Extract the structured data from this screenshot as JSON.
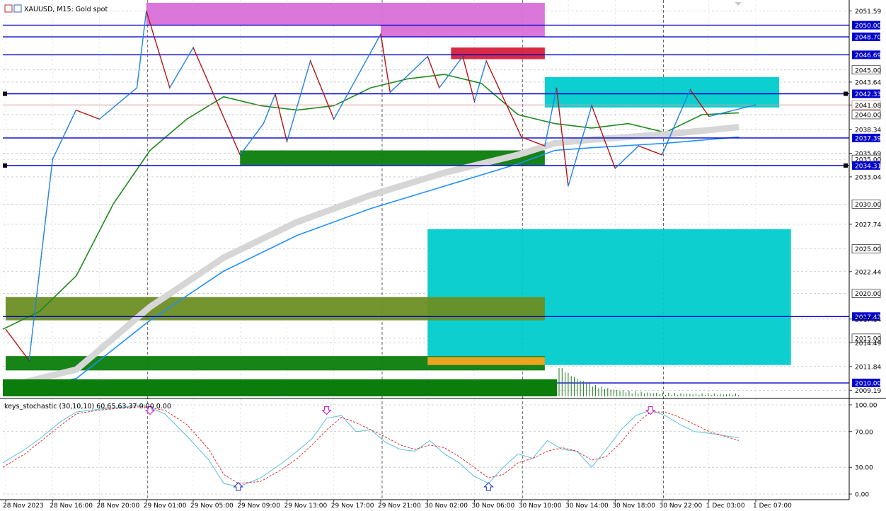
{
  "window": {
    "symbol": "XAUUSD",
    "timeframe": "M15",
    "description": "Gold spot",
    "title_text": "XAUUSD, M15:  Gold spot"
  },
  "colors": {
    "background": "#ffffff",
    "bull_candle": "#000000",
    "level_line": "#0000cc",
    "sma_green": "#1f8a1f",
    "sma_blue": "#1e90ff",
    "ribbon_gray": "#d6d6d6",
    "zone_magenta": "#d96fd9",
    "zone_red": "#d41f3b",
    "zone_cyan": "#00cccc",
    "zone_green": "#0a7d0a",
    "zone_olive": "#6b8e23",
    "zone_orange": "#f5a623",
    "zone_beige": "#fdebd3",
    "zone_lavender": "#e6e6f7",
    "stoch_main": "#5bc0de",
    "stoch_signal": "#e03030"
  },
  "chart_data": [
    {
      "type": "candlestick",
      "symbol": "XAUUSD",
      "timeframe": "M15",
      "title": "XAUUSD, M15:  Gold spot",
      "ylim": [
        2008.5,
        2052.5
      ],
      "grid": true,
      "y_ticks": [
        "2051.59",
        "2050.00",
        "2048.70",
        "2046.69",
        "2045.00",
        "2043.64",
        "2042.33",
        "2041.08",
        "2040.00",
        "2038.34",
        "2037.39",
        "2035.69",
        "2035.00",
        "2034.31",
        "2033.04",
        "2030.00",
        "2027.74",
        "2025.00",
        "2022.44",
        "2020.00",
        "2017.42",
        "2017.14",
        "2015.00",
        "2014.49",
        "2011.84",
        "2010.00",
        "2009.19"
      ],
      "x_ticks": [
        "28 Nov 2023",
        "28 Nov 16:00",
        "28 Nov 20:00",
        "29 Nov 01:00",
        "29 Nov 05:00",
        "29 Nov 09:00",
        "29 Nov 13:00",
        "29 Nov 17:00",
        "29 Nov 21:00",
        "30 Nov 02:00",
        "30 Nov 06:00",
        "30 Nov 10:00",
        "30 Nov 14:00",
        "30 Nov 18:00",
        "30 Nov 22:00",
        "1 Dec 03:00",
        "1 Dec 07:00"
      ],
      "horizontal_levels": [
        {
          "price": 2050.0,
          "label": "2050.00"
        },
        {
          "price": 2048.7,
          "label": "2048.70"
        },
        {
          "price": 2046.69,
          "label": "2046.69"
        },
        {
          "price": 2042.33,
          "label": "2042.33"
        },
        {
          "price": 2037.39,
          "label": "2037.39"
        },
        {
          "price": 2034.31,
          "label": "2034.31"
        },
        {
          "price": 2017.42,
          "label": "2017.42"
        },
        {
          "price": 2010.0,
          "label": "2010.00"
        }
      ],
      "current_price": {
        "price": 2041.08,
        "label": "2041.08"
      },
      "highlighted_labels": [
        "2045.00",
        "2040.00",
        "2035.00",
        "2030.00",
        "2025.00",
        "2020.00",
        "2015.00"
      ],
      "price_path": [
        {
          "time": "28 Nov 2023",
          "price": 2016.0
        },
        {
          "time": "28 Nov 14:00",
          "price": 2012.5
        },
        {
          "time": "28 Nov 16:00",
          "price": 2035.0
        },
        {
          "time": "28 Nov 18:00",
          "price": 2040.5
        },
        {
          "time": "28 Nov 20:00",
          "price": 2039.5
        },
        {
          "time": "29 Nov 00:00",
          "price": 2043.0
        },
        {
          "time": "29 Nov 01:00",
          "price": 2051.6
        },
        {
          "time": "29 Nov 03:00",
          "price": 2043.0
        },
        {
          "time": "29 Nov 05:00",
          "price": 2047.5
        },
        {
          "time": "29 Nov 09:00",
          "price": 2035.5
        },
        {
          "time": "29 Nov 11:00",
          "price": 2039.0
        },
        {
          "time": "29 Nov 12:00",
          "price": 2042.3
        },
        {
          "time": "29 Nov 13:00",
          "price": 2037.0
        },
        {
          "time": "29 Nov 15:00",
          "price": 2046.0
        },
        {
          "time": "29 Nov 17:00",
          "price": 2039.5
        },
        {
          "time": "29 Nov 21:00",
          "price": 2049.0
        },
        {
          "time": "29 Nov 22:00",
          "price": 2042.5
        },
        {
          "time": "30 Nov 02:00",
          "price": 2046.5
        },
        {
          "time": "30 Nov 03:00",
          "price": 2043.0
        },
        {
          "time": "30 Nov 05:00",
          "price": 2046.5
        },
        {
          "time": "30 Nov 06:00",
          "price": 2041.5
        },
        {
          "time": "30 Nov 07:00",
          "price": 2046.0
        },
        {
          "time": "30 Nov 10:00",
          "price": 2037.5
        },
        {
          "time": "30 Nov 12:00",
          "price": 2036.5
        },
        {
          "time": "30 Nov 13:00",
          "price": 2043.0
        },
        {
          "time": "30 Nov 14:00",
          "price": 2032.0
        },
        {
          "time": "30 Nov 16:00",
          "price": 2041.0
        },
        {
          "time": "30 Nov 18:00",
          "price": 2034.0
        },
        {
          "time": "30 Nov 20:00",
          "price": 2036.5
        },
        {
          "time": "30 Nov 22:00",
          "price": 2035.5
        },
        {
          "time": "1 Dec 01:00",
          "price": 2042.8
        },
        {
          "time": "1 Dec 03:00",
          "price": 2039.8
        },
        {
          "time": "1 Dec 07:00",
          "price": 2041.1
        }
      ],
      "moving_averages": [
        {
          "color": "#1f8a1f",
          "points": [
            [
              0,
              2016.0
            ],
            [
              0.05,
              2018
            ],
            [
              0.1,
              2022
            ],
            [
              0.15,
              2030
            ],
            [
              0.2,
              2036
            ],
            [
              0.25,
              2039.5
            ],
            [
              0.3,
              2042
            ],
            [
              0.35,
              2041
            ],
            [
              0.4,
              2040.5
            ],
            [
              0.45,
              2041
            ],
            [
              0.5,
              2043
            ],
            [
              0.55,
              2044
            ],
            [
              0.6,
              2044.5
            ],
            [
              0.65,
              2043.5
            ],
            [
              0.7,
              2040
            ],
            [
              0.75,
              2039
            ],
            [
              0.8,
              2038.5
            ],
            [
              0.85,
              2039
            ],
            [
              0.9,
              2038
            ],
            [
              0.95,
              2040
            ],
            [
              1.0,
              2040.2
            ]
          ]
        },
        {
          "color": "#1e90ff",
          "points": [
            [
              0,
              2008.8
            ],
            [
              0.1,
              2010.5
            ],
            [
              0.2,
              2017
            ],
            [
              0.3,
              2022.5
            ],
            [
              0.4,
              2026.5
            ],
            [
              0.5,
              2029.5
            ],
            [
              0.6,
              2032
            ],
            [
              0.7,
              2034.5
            ],
            [
              0.75,
              2036
            ],
            [
              0.8,
              2036.3
            ],
            [
              0.9,
              2036.8
            ],
            [
              1.0,
              2037.5
            ]
          ]
        },
        {
          "color": "#d6d6d6",
          "points": [
            [
              0,
              2009.5
            ],
            [
              0.1,
              2011.5
            ],
            [
              0.2,
              2018.5
            ],
            [
              0.3,
              2024
            ],
            [
              0.4,
              2028
            ],
            [
              0.5,
              2031
            ],
            [
              0.6,
              2033.5
            ],
            [
              0.7,
              2035.5
            ],
            [
              0.75,
              2036.8
            ],
            [
              0.8,
              2037.2
            ],
            [
              0.9,
              2037.8
            ],
            [
              1.0,
              2038.6
            ]
          ]
        }
      ],
      "zones": [
        {
          "color": "#d96fd9",
          "price_from": 2050.0,
          "price_to": 2052.5,
          "time_from": "29 Nov 01:00",
          "time_to": "30 Nov 12:00"
        },
        {
          "color": "#d96fd9",
          "price_from": 2048.7,
          "price_to": 2050.0,
          "time_from": "29 Nov 21:00",
          "time_to": "30 Nov 12:00"
        },
        {
          "color": "#d41f3b",
          "price_from": 2046.2,
          "price_to": 2047.5,
          "time_from": "30 Nov 04:00",
          "time_to": "30 Nov 12:00"
        },
        {
          "color": "#00cccc",
          "price_from": 2040.8,
          "price_to": 2044.2,
          "time_from": "30 Nov 12:00",
          "time_to": "1 Dec 09:00"
        },
        {
          "color": "#00cccc",
          "price_from": 2012.0,
          "price_to": 2027.2,
          "time_from": "30 Nov 02:00",
          "time_to": "1 Dec 10:00"
        },
        {
          "color": "#0a7d0a",
          "price_from": 2034.31,
          "price_to": 2036.0,
          "time_from": "29 Nov 09:00",
          "time_to": "30 Nov 12:00"
        },
        {
          "color": "#6b8e23",
          "price_from": 2017.0,
          "price_to": 2019.6,
          "time_from": "28 Nov 2023",
          "time_to": "30 Nov 12:00"
        },
        {
          "color": "#0a7d0a",
          "price_from": 2011.4,
          "price_to": 2013.0,
          "time_from": "28 Nov 2023",
          "time_to": "30 Nov 12:00"
        },
        {
          "color": "#f5a623",
          "price_from": 2012.0,
          "price_to": 2012.9,
          "time_from": "30 Nov 02:00",
          "time_to": "30 Nov 12:00"
        }
      ]
    },
    {
      "type": "line",
      "indicator": "keys_stochastic (30,10,10)",
      "header_text": "keys_stochastic (30,10,10) 60.65 63.37 0.00 0.00",
      "values_shown": [
        60.65,
        63.37,
        0.0,
        0.0
      ],
      "ylim": [
        0,
        100
      ],
      "y_ticks": [
        "100.00",
        "70.00",
        "30.00",
        "0.00"
      ],
      "series": [
        {
          "values": [
            [
              0,
              35
            ],
            [
              0.03,
              50
            ],
            [
              0.05,
              62
            ],
            [
              0.08,
              82
            ],
            [
              0.1,
              92
            ],
            [
              0.13,
              95
            ],
            [
              0.17,
              98
            ],
            [
              0.19,
              100
            ],
            [
              0.22,
              90
            ],
            [
              0.25,
              65
            ],
            [
              0.28,
              38
            ],
            [
              0.3,
              12
            ],
            [
              0.32,
              8
            ],
            [
              0.35,
              18
            ],
            [
              0.38,
              35
            ],
            [
              0.4,
              48
            ],
            [
              0.42,
              62
            ],
            [
              0.44,
              85
            ],
            [
              0.46,
              88
            ],
            [
              0.48,
              70
            ],
            [
              0.5,
              72
            ],
            [
              0.52,
              58
            ],
            [
              0.54,
              50
            ],
            [
              0.56,
              48
            ],
            [
              0.58,
              60
            ],
            [
              0.6,
              45
            ],
            [
              0.62,
              35
            ],
            [
              0.64,
              20
            ],
            [
              0.66,
              12
            ],
            [
              0.68,
              30
            ],
            [
              0.7,
              45
            ],
            [
              0.72,
              40
            ],
            [
              0.74,
              60
            ],
            [
              0.76,
              50
            ],
            [
              0.78,
              48
            ],
            [
              0.8,
              30
            ],
            [
              0.82,
              50
            ],
            [
              0.84,
              72
            ],
            [
              0.86,
              88
            ],
            [
              0.88,
              94
            ],
            [
              0.9,
              88
            ],
            [
              0.92,
              78
            ],
            [
              0.94,
              70
            ],
            [
              0.96,
              68
            ],
            [
              1.0,
              63
            ]
          ]
        },
        {
          "values": [
            [
              0,
              30
            ],
            [
              0.03,
              45
            ],
            [
              0.05,
              58
            ],
            [
              0.08,
              78
            ],
            [
              0.1,
              90
            ],
            [
              0.13,
              94
            ],
            [
              0.17,
              97
            ],
            [
              0.19,
              98
            ],
            [
              0.22,
              94
            ],
            [
              0.25,
              78
            ],
            [
              0.28,
              50
            ],
            [
              0.3,
              22
            ],
            [
              0.32,
              12
            ],
            [
              0.35,
              14
            ],
            [
              0.38,
              28
            ],
            [
              0.4,
              40
            ],
            [
              0.42,
              55
            ],
            [
              0.44,
              72
            ],
            [
              0.46,
              86
            ],
            [
              0.48,
              80
            ],
            [
              0.5,
              72
            ],
            [
              0.52,
              64
            ],
            [
              0.54,
              55
            ],
            [
              0.56,
              50
            ],
            [
              0.58,
              55
            ],
            [
              0.6,
              52
            ],
            [
              0.62,
              42
            ],
            [
              0.64,
              30
            ],
            [
              0.66,
              18
            ],
            [
              0.68,
              22
            ],
            [
              0.7,
              35
            ],
            [
              0.72,
              40
            ],
            [
              0.74,
              48
            ],
            [
              0.76,
              52
            ],
            [
              0.78,
              48
            ],
            [
              0.8,
              38
            ],
            [
              0.82,
              42
            ],
            [
              0.84,
              58
            ],
            [
              0.86,
              78
            ],
            [
              0.88,
              92
            ],
            [
              0.9,
              92
            ],
            [
              0.92,
              86
            ],
            [
              0.94,
              78
            ],
            [
              0.96,
              70
            ],
            [
              1.0,
              60
            ]
          ]
        }
      ],
      "markers": [
        {
          "kind": "down-arrow",
          "at": 0.2
        },
        {
          "kind": "up-arrow",
          "at": 0.32
        },
        {
          "kind": "down-arrow",
          "at": 0.44
        },
        {
          "kind": "up-arrow",
          "at": 0.66
        },
        {
          "kind": "down-arrow",
          "at": 0.88
        }
      ]
    }
  ]
}
